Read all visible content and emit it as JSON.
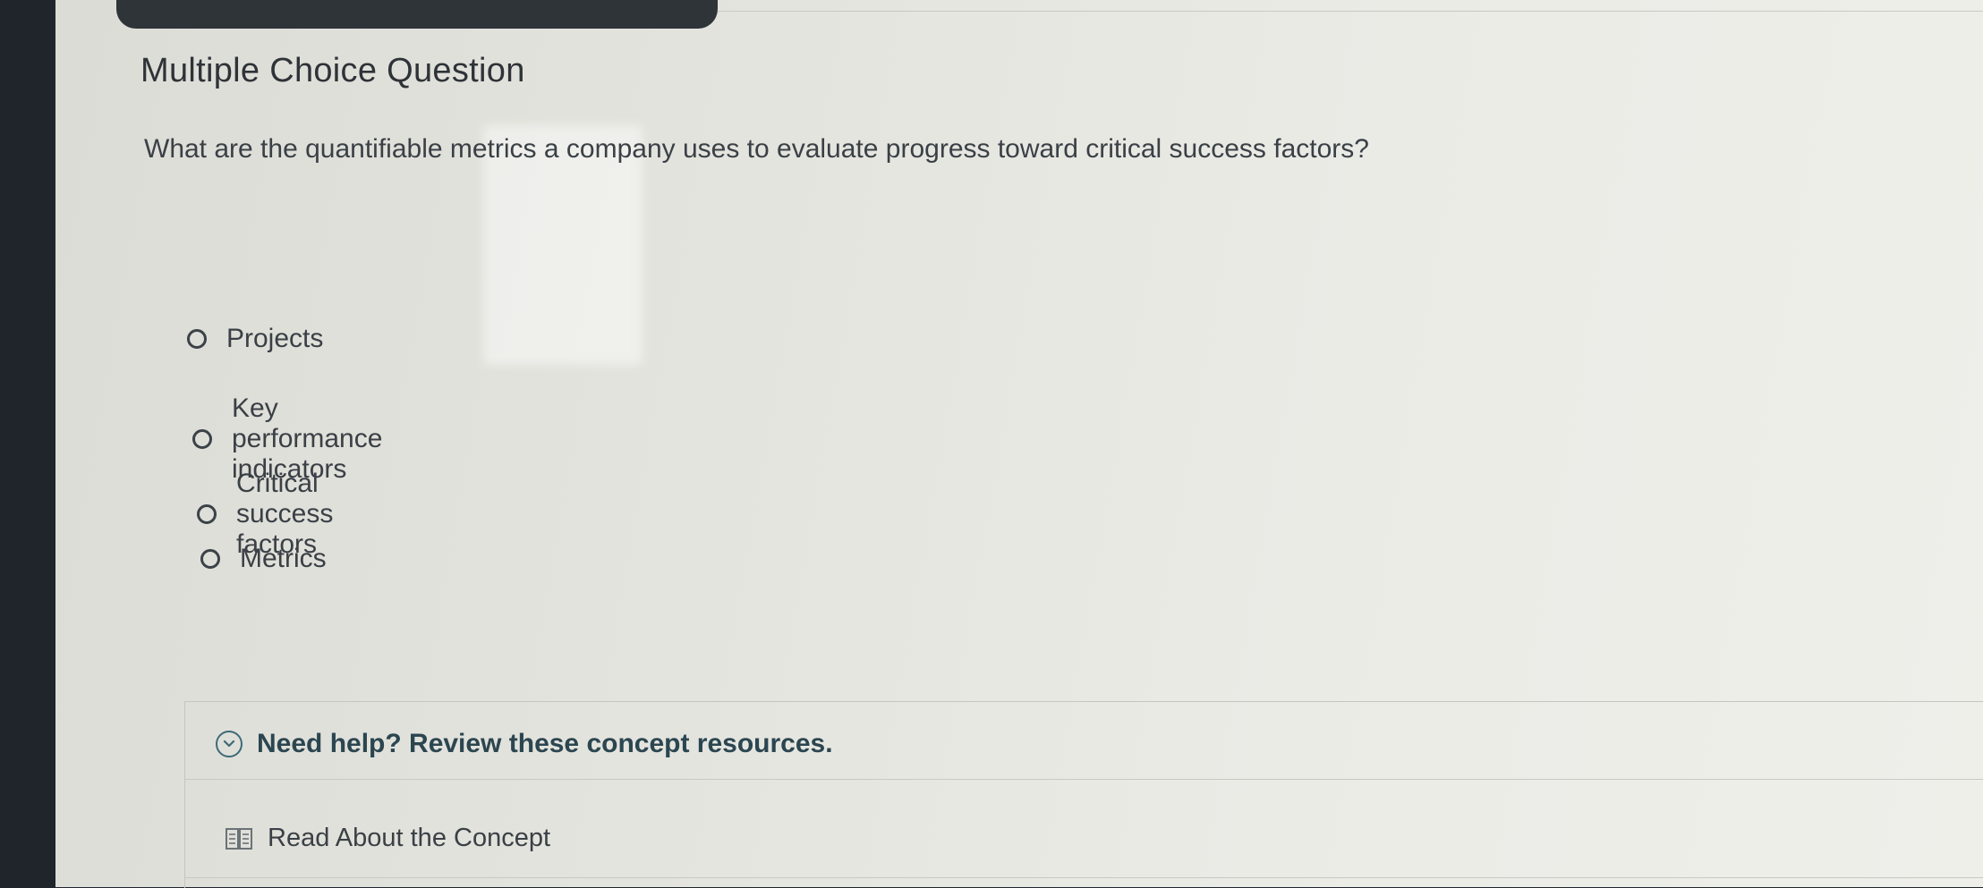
{
  "question": {
    "heading": "Multiple Choice Question",
    "prompt": "What are the quantifiable metrics a company uses to evaluate progress toward critical success factors?"
  },
  "choices": [
    {
      "label": "Projects"
    },
    {
      "label": "Key performance indicators"
    },
    {
      "label": "Critical success factors"
    },
    {
      "label": "Metrics"
    }
  ],
  "help": {
    "toggle_label": "Need help? Review these concept resources.",
    "toggle_icon": "chevron-down-icon",
    "resource_label": "Read About the Concept",
    "resource_icon": "book-icon"
  },
  "colors": {
    "accent": "#3e6a77",
    "text": "#3a4046",
    "sidebar": "#1f252b"
  }
}
